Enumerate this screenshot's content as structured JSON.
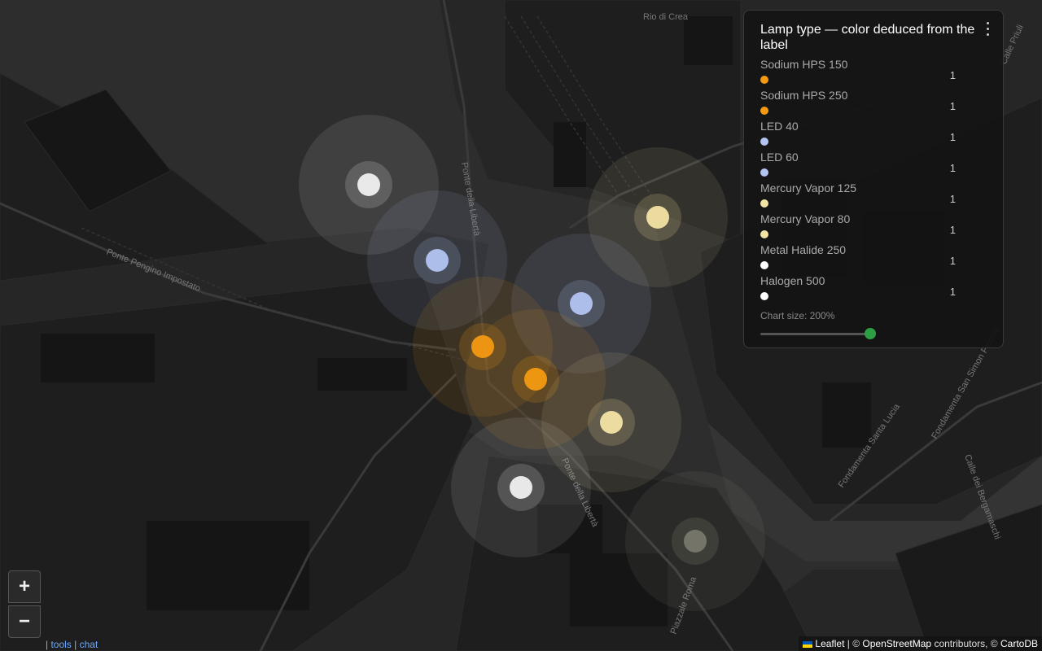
{
  "map": {
    "street_labels": [
      "Ponte della Libertà",
      "Ponte Pengino Impostato",
      "Rio di Crea",
      "Fondamenta Santa Lucia",
      "Fondamenta San Simon Piccolo",
      "Calle dei Bergamaschi",
      "Piazzale Roma",
      "Calle Priuli"
    ],
    "markers": [
      {
        "type": "Metal Halide 250",
        "color": "#f0f0f0"
      },
      {
        "type": "LED 40",
        "color": "#b3c4f2"
      },
      {
        "type": "Mercury Vapor 125",
        "color": "#f3e3a4"
      },
      {
        "type": "LED 60",
        "color": "#b3c4f2"
      },
      {
        "type": "Sodium HPS 150",
        "color": "#f39a12"
      },
      {
        "type": "Sodium HPS 250",
        "color": "#f39a12"
      },
      {
        "type": "Mercury Vapor 80",
        "color": "#f3e3a4"
      },
      {
        "type": "Halogen 500",
        "color": "#f0f0f0"
      },
      {
        "type": "Unknown",
        "color": "#9a9a8a"
      }
    ]
  },
  "legend": {
    "title": "Lamp type — color deduced from the label",
    "items": [
      {
        "label": "Sodium HPS 150",
        "color": "#f39a12",
        "count": "1"
      },
      {
        "label": "Sodium HPS 250",
        "color": "#f39a12",
        "count": "1"
      },
      {
        "label": "LED 40",
        "color": "#b3c4f2",
        "count": "1"
      },
      {
        "label": "LED 60",
        "color": "#b3c4f2",
        "count": "1"
      },
      {
        "label": "Mercury Vapor 125",
        "color": "#f3e3a4",
        "count": "1"
      },
      {
        "label": "Mercury Vapor 80",
        "color": "#f3e3a4",
        "count": "1"
      },
      {
        "label": "Metal Halide 250",
        "color": "#ffffff",
        "count": "1"
      },
      {
        "label": "Halogen 500",
        "color": "#ffffff",
        "count": "1"
      }
    ],
    "chart_size_label": "Chart size: 200%",
    "chart_size_value": 200,
    "chart_size_fraction": 1.0
  },
  "zoom": {
    "in_label": "+",
    "out_label": "−"
  },
  "footer_links": {
    "tools": "tools",
    "chat": "chat"
  },
  "attribution": {
    "leaflet": "Leaflet",
    "sep1": " | © ",
    "osm": "OpenStreetMap",
    "contrib": " contributors, © ",
    "carto": "CartoDB"
  }
}
